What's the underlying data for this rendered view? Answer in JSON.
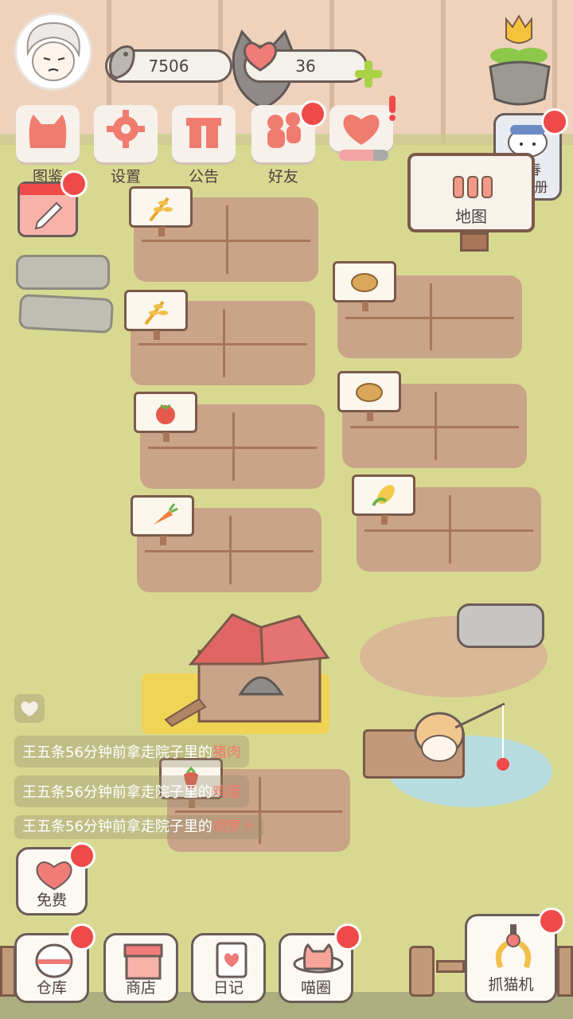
{
  "top": {
    "fish_count": "7506",
    "heart_count": "36"
  },
  "menu": [
    {
      "label": "图鉴"
    },
    {
      "label": "设置"
    },
    {
      "label": "公告"
    },
    {
      "label": "好友"
    },
    {
      "label": ""
    }
  ],
  "map_sign": {
    "label": "地图"
  },
  "album": {
    "line1": "青春",
    "line2": "纪念册"
  },
  "messages": [
    {
      "prefix": "王五条56分钟前拿走院子里的",
      "item": "猪肉"
    },
    {
      "prefix": "王五条56分钟前拿走院子里的",
      "item": "鸡蛋"
    },
    {
      "prefix": "王五条56分钟前拿走院子里的",
      "item": "胡萝卜"
    }
  ],
  "free_button": {
    "label": "免费"
  },
  "bottom_nav": [
    {
      "label": "仓库"
    },
    {
      "label": "商店"
    },
    {
      "label": "日记"
    },
    {
      "label": "喵圈"
    }
  ],
  "claw": {
    "label": "抓猫机"
  },
  "colors": {
    "badge": "#ef4a4a",
    "text": "#4d4240",
    "highlight": "#f37a6a"
  }
}
